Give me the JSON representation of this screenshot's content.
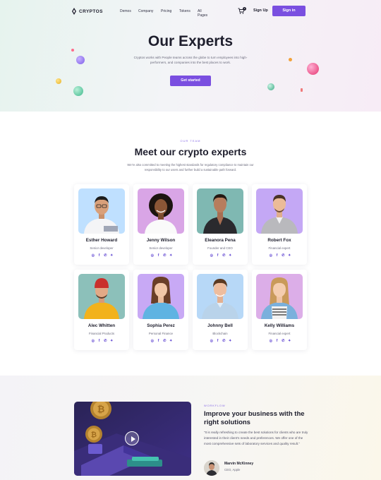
{
  "nav": {
    "brand": "CRYPTOS",
    "items": [
      "Demos",
      "Company",
      "Pricing",
      "Tokens",
      "All Pages"
    ],
    "cart_count": "2",
    "signup_label": "Sign Up",
    "signin_label": "Sign in"
  },
  "hero": {
    "title": "Our Experts",
    "subtitle": "Cryptos works with People teams across the globe to turn  employees into high-performers, and companies into the best places to work.",
    "cta_label": "Get started"
  },
  "team": {
    "eyebrow": "OUR TEAM",
    "title": "Meet our crypto experts",
    "description": "We’re also committed to meeting the highest standards for regulatory compliance to maintain our responsibility to our users and further build a sustainable path forward.",
    "members": [
      {
        "name": "Esther Howard",
        "role": "Senior developer"
      },
      {
        "name": "Jenny Wilson",
        "role": "Senior developer"
      },
      {
        "name": "Eleanora Pena",
        "role": "Founder and CEO"
      },
      {
        "name": "Robert Fox",
        "role": "Financial expert"
      },
      {
        "name": "Alec Whitten",
        "role": "Financial Products"
      },
      {
        "name": "Sophia Perez",
        "role": "Personal Finance"
      },
      {
        "name": "Johnny Bell",
        "role": "Blockchain"
      },
      {
        "name": "Kelly Williams",
        "role": "Financial expert"
      }
    ],
    "social_icons": [
      "instagram-icon",
      "facebook-icon",
      "whatsapp-icon",
      "twitter-icon"
    ]
  },
  "workflow": {
    "eyebrow": "WORKFLOW",
    "title": "Improve your business with the right solutions",
    "quote": "“It is really refreshing to create the best solutions for clients who are truly interested in their client’s needs and preferences. We offer one of the most comprehensive sets of laboratory services and quality result.”",
    "author_name": "Marvin McKinney",
    "author_role": "CEO, Apple"
  },
  "colors": {
    "accent": "#7a4fe0",
    "text_dark": "#1e1e2d",
    "text_muted": "#6c6c7e"
  }
}
